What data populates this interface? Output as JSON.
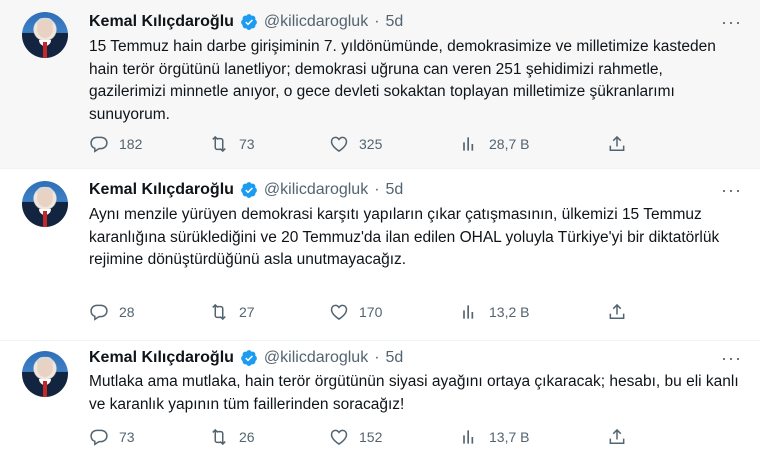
{
  "tweets": [
    {
      "author_name": "Kemal Kılıçdaroğlu",
      "handle": "@kilicdarogluk",
      "separator": "·",
      "age": "5d",
      "more": "···",
      "text": "15 Temmuz hain darbe girişiminin 7. yıldönümünde, demokrasimize ve milletimize kasteden hain terör örgütünü lanetliyor; demokrasi uğruna can veren 251 şehidimizi rahmetle, gazilerimizi minnetle anıyor, o gece devleti sokaktan toplayan milletimize şükranlarımı sunuyorum.",
      "replies": "182",
      "retweets": "73",
      "likes": "325",
      "views": "28,7 B"
    },
    {
      "author_name": "Kemal Kılıçdaroğlu",
      "handle": "@kilicdarogluk",
      "separator": "·",
      "age": "5d",
      "more": "···",
      "text": "Aynı menzile yürüyen demokrasi karşıtı yapıların çıkar çatışmasının, ülkemizi 15 Temmuz karanlığına sürüklediğini ve 20 Temmuz'da ilan edilen OHAL yoluyla Türkiye'yi bir diktatörlük rejimine dönüştürdüğünü asla unutmayacağız.",
      "replies": "28",
      "retweets": "27",
      "likes": "170",
      "views": "13,2 B"
    },
    {
      "author_name": "Kemal Kılıçdaroğlu",
      "handle": "@kilicdarogluk",
      "separator": "·",
      "age": "5d",
      "more": "···",
      "text": "Mutlaka ama mutlaka, hain terör örgütünün siyasi ayağını ortaya çıkaracak; hesabı, bu eli kanlı ve karanlık yapının tüm faillerinden soracağız!",
      "replies": "73",
      "retweets": "26",
      "likes": "152",
      "views": "13,7 B"
    }
  ],
  "icons": {
    "verified": "verified-badge-icon",
    "reply": "reply-icon",
    "retweet": "retweet-icon",
    "like": "heart-icon",
    "views": "views-icon",
    "share": "share-icon"
  },
  "colors": {
    "verified": "#1d9bf0",
    "muted": "#536471",
    "text": "#0f1419"
  }
}
